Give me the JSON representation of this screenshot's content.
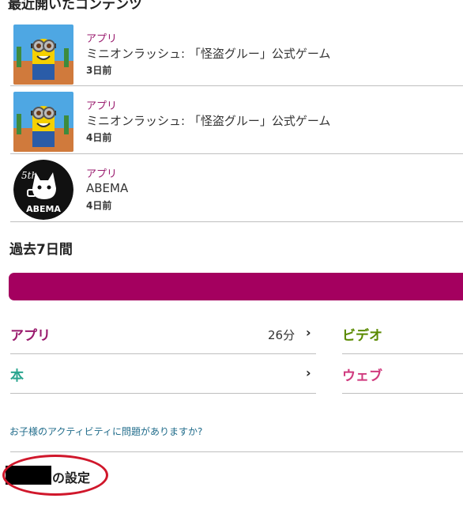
{
  "recent": {
    "title": "最近開いたコンテンツ",
    "items": [
      {
        "category": "アプリ",
        "name": "ミニオンラッシュ: 「怪盗グルー」公式ゲーム",
        "ago": "3日前",
        "icon": "minion-app-icon"
      },
      {
        "category": "アプリ",
        "name": "ミニオンラッシュ: 「怪盗グルー」公式ゲーム",
        "ago": "4日前",
        "icon": "minion-app-icon"
      },
      {
        "category": "アプリ",
        "name": "ABEMA",
        "ago": "4日前",
        "icon": "abema-app-icon",
        "logo_text": "ABEMA",
        "badge_text": "5th"
      }
    ]
  },
  "week": {
    "title": "過去7日間",
    "bar_color": "#a4005f",
    "grid": {
      "app": {
        "label": "アプリ",
        "value": "26分",
        "color": "#9a1b6e"
      },
      "video": {
        "label": "ビデオ",
        "color": "#5a8a00"
      },
      "book": {
        "label": "本",
        "color": "#2aa58f"
      },
      "web": {
        "label": "ウェブ",
        "color": "#d03a7e"
      }
    }
  },
  "help_link": "お子様のアクティビティに問題がありますか?",
  "settings": {
    "suffix": "の設定"
  }
}
